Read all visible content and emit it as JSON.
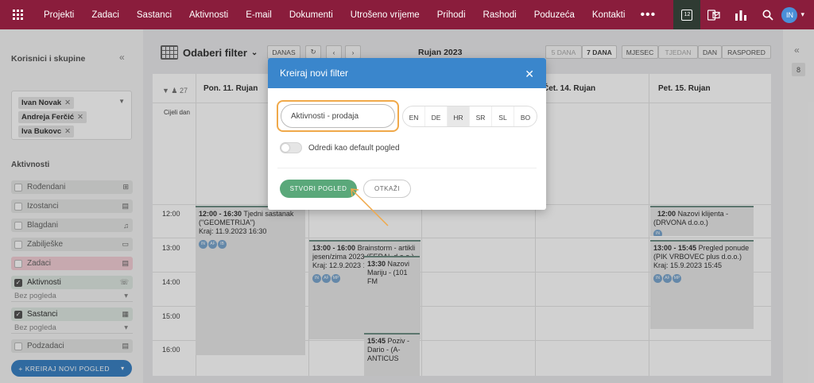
{
  "nav": {
    "items": [
      "Projekti",
      "Zadaci",
      "Sastanci",
      "Aktivnosti",
      "E-mail",
      "Dokumenti",
      "Utrošeno vrijeme",
      "Prihodi",
      "Rashodi",
      "Poduzeća",
      "Kontakti"
    ],
    "more": "•••",
    "calendar_day": "12",
    "avatar_initials": "IN"
  },
  "sidebar": {
    "title": "Korisnici i skupine",
    "users": [
      "Ivan Novak",
      "Andreja Ferčić",
      "Iva Bukovc"
    ],
    "section_title": "Aktivnosti",
    "categories": [
      {
        "label": "Rođendani",
        "checked": false,
        "color": "#e4e6e4"
      },
      {
        "label": "Izostanci",
        "checked": false,
        "color": "#e4e6e4"
      },
      {
        "label": "Blagdani",
        "checked": false,
        "color": "#e4e6e4"
      },
      {
        "label": "Zabilješke",
        "checked": false,
        "color": "#e4e6e4"
      },
      {
        "label": "Zadaci",
        "checked": false,
        "color": "#f3cfd6"
      },
      {
        "label": "Aktivnosti",
        "checked": true,
        "color": "#dfe8e2"
      },
      {
        "label": "Sastanci",
        "checked": true,
        "color": "#dfe8e2"
      },
      {
        "label": "Podzadaci",
        "checked": false,
        "color": "#e4e6e4"
      }
    ],
    "subselect": "Bez pogleda",
    "create_button": "+ KREIRAJ NOVI POGLED"
  },
  "toolbar": {
    "filter_title": "Odaberi filter",
    "today": "DANAS",
    "period": "Rujan 2023",
    "view_5days": "5 DANA",
    "view_7days": "7 DANA",
    "view_month": "MJESEC",
    "view_week": "TJEDAN",
    "view_day": "DAN",
    "view_schedule": "RASPORED"
  },
  "calendar": {
    "header_count": "27",
    "allday_label": "Cijeli dan",
    "days": [
      "Pon. 11. Rujan",
      "Čet. 14. Rujan",
      "Pet. 15. Rujan"
    ],
    "times": [
      "12:00",
      "13:00",
      "14:00",
      "15:00",
      "16:00"
    ],
    "events": [
      {
        "time": "12:00 - 16:30",
        "title": "Tjedni sastanak (\"GEOMETRIJA\")",
        "end": "Kraj: 11.9.2023 16:30",
        "avatars": [
          "IN",
          "AF",
          "IB"
        ]
      },
      {
        "time": "13:00 - 16:00",
        "title": "Brainstorm - artikli jesen/zima 2023 (FERAL d.o.o.)",
        "end": "Kraj: 12.9.2023 1",
        "avatars": [
          "IN",
          "AF",
          "MP"
        ]
      },
      {
        "time": "13:30",
        "title": "Nazovi Mariju - (101 FM"
      },
      {
        "time": "15:45",
        "title": "Poziv - Dario - (A-ANTICUS"
      },
      {
        "time": "12:00",
        "title": "Nazovi klijenta - (DRVONA d.o.o.)",
        "avatars": [
          "IN"
        ]
      },
      {
        "time": "13:00 - 15:45",
        "title": "Pregled ponude (PIK VRBOVEC plus d.o.o.)",
        "end": "Kraj: 15.9.2023 15:45",
        "avatars": [
          "IN",
          "AF",
          "MP"
        ]
      }
    ]
  },
  "right_panel": {
    "badge": "8"
  },
  "modal": {
    "title": "Kreiraj novi filter",
    "name_value": "Aktivnosti - prodaja",
    "languages": [
      "EN",
      "DE",
      "HR",
      "SR",
      "SL",
      "BO"
    ],
    "active_language": "HR",
    "default_toggle_label": "Odredi kao default pogled",
    "create_label": "STVORI POGLED",
    "cancel_label": "OTKAŽI"
  },
  "colors": {
    "nav_bg": "#8a1d3c",
    "modal_header": "#3a86cc",
    "primary_green": "#5aa87a",
    "highlight": "#f0a94a",
    "sidebar_button": "#3b82c4"
  }
}
